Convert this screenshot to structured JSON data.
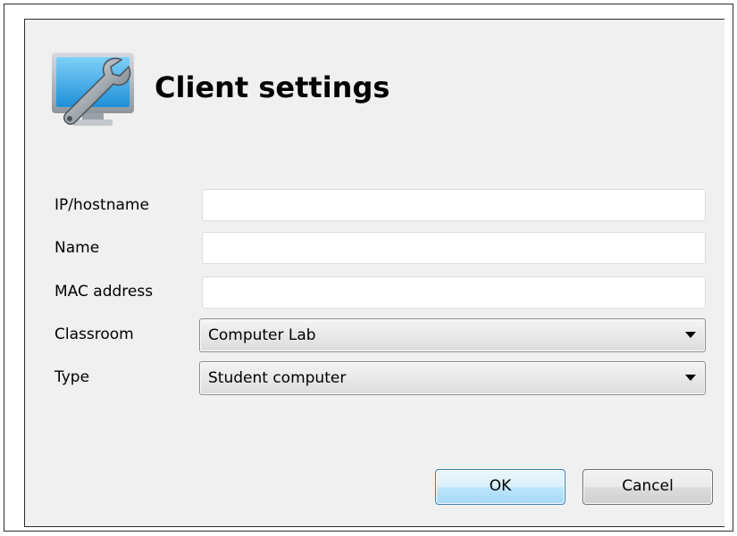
{
  "dialog": {
    "title": "Client settings",
    "header_icon": "computer-wrench-icon"
  },
  "form": {
    "ip_hostname": {
      "label": "IP/hostname",
      "value": ""
    },
    "name": {
      "label": "Name",
      "value": ""
    },
    "mac_address": {
      "label": "MAC address",
      "value": ""
    },
    "classroom": {
      "label": "Classroom",
      "value": "Computer Lab"
    },
    "type": {
      "label": "Type",
      "value": "Student computer"
    }
  },
  "buttons": {
    "ok_label": "OK",
    "cancel_label": "Cancel"
  },
  "colors": {
    "dialog_background": "#f0f0f0",
    "ok_border": "#3c7fb1"
  }
}
